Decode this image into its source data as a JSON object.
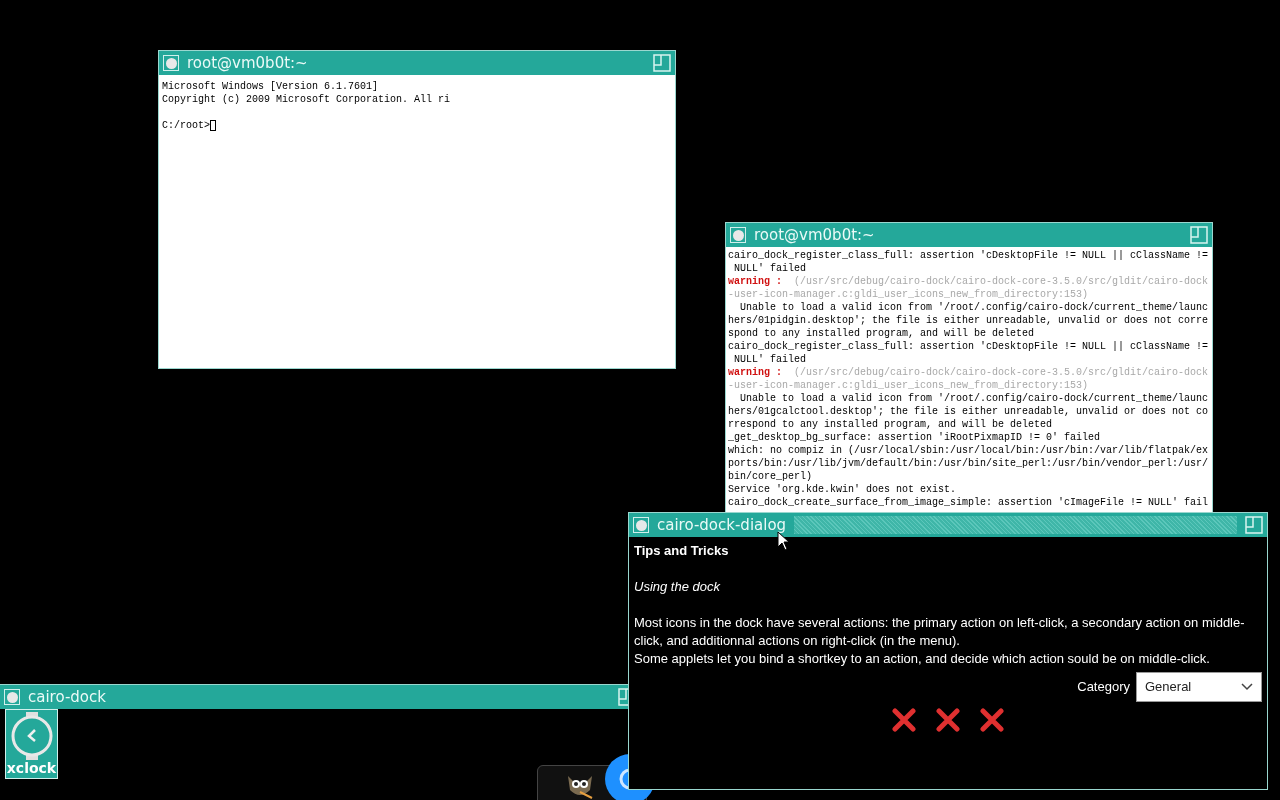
{
  "terminal_1": {
    "title": "root@vm0b0t:~",
    "lines": [
      {
        "kind": "text",
        "text": "Microsoft Windows [Version 6.1.7601]"
      },
      {
        "kind": "text",
        "text": "Copyright (c) 2009 Microsoft Corporation. All ri"
      },
      {
        "kind": "blank"
      },
      {
        "kind": "prompt",
        "text": "C:/root>"
      }
    ]
  },
  "terminal_2": {
    "title": "root@vm0b0t:~",
    "lines": [
      {
        "kind": "normal",
        "text": "cairo_dock_register_class_full: assertion 'cDesktopFile != NULL || cClassName !="
      },
      {
        "kind": "normal",
        "text": " NULL' failed"
      },
      {
        "kind": "warning",
        "label": "warning :",
        "text": "  (/usr/src/debug/cairo-dock/cairo-dock-core-3.5.0/src/gldit/cairo-dock"
      },
      {
        "kind": "faint",
        "text": "-user-icon-manager.c:gldi_user_icons_new_from_directory:153)"
      },
      {
        "kind": "normal",
        "text": "  Unable to load a valid icon from '/root/.config/cairo-dock/current_theme/launc"
      },
      {
        "kind": "normal",
        "text": "hers/01pidgin.desktop'; the file is either unreadable, unvalid or does not corre"
      },
      {
        "kind": "normal",
        "text": "spond to any installed program, and will be deleted"
      },
      {
        "kind": "normal",
        "text": "cairo_dock_register_class_full: assertion 'cDesktopFile != NULL || cClassName !="
      },
      {
        "kind": "normal",
        "text": " NULL' failed"
      },
      {
        "kind": "warning",
        "label": "warning :",
        "text": "  (/usr/src/debug/cairo-dock/cairo-dock-core-3.5.0/src/gldit/cairo-dock"
      },
      {
        "kind": "faint",
        "text": "-user-icon-manager.c:gldi_user_icons_new_from_directory:153)"
      },
      {
        "kind": "normal",
        "text": "  Unable to load a valid icon from '/root/.config/cairo-dock/current_theme/launc"
      },
      {
        "kind": "normal",
        "text": "hers/01gcalctool.desktop'; the file is either unreadable, unvalid or does not co"
      },
      {
        "kind": "normal",
        "text": "rrespond to any installed program, and will be deleted"
      },
      {
        "kind": "normal",
        "text": "_get_desktop_bg_surface: assertion 'iRootPixmapID != 0' failed"
      },
      {
        "kind": "normal",
        "text": "which: no compiz in (/usr/local/sbin:/usr/local/bin:/usr/bin:/var/lib/flatpak/ex"
      },
      {
        "kind": "normal",
        "text": "ports/bin:/usr/lib/jvm/default/bin:/usr/bin/site_perl:/usr/bin/vendor_perl:/usr/"
      },
      {
        "kind": "normal",
        "text": "bin/core_perl)"
      },
      {
        "kind": "normal",
        "text": "Service 'org.kde.kwin' does not exist."
      },
      {
        "kind": "normal",
        "text": "cairo_dock_create_surface_from_image_simple: assertion 'cImageFile != NULL' fail"
      }
    ]
  },
  "dialog": {
    "title": "cairo-dock-dialog",
    "heading": "Tips and Tricks",
    "subheading": "Using the dock",
    "paragraphs": [
      "Most icons in the dock have several actions: the primary action on left-click, a secondary action on middle-click, and additionnal actions on right-click (in the menu).",
      "Some applets let you bind a shortkey to an action, and decide which action sould be on middle-click."
    ],
    "category_label": "Category",
    "category_value": "General"
  },
  "dock_window": {
    "title": "cairo-dock",
    "launcher_label": "xclock"
  }
}
